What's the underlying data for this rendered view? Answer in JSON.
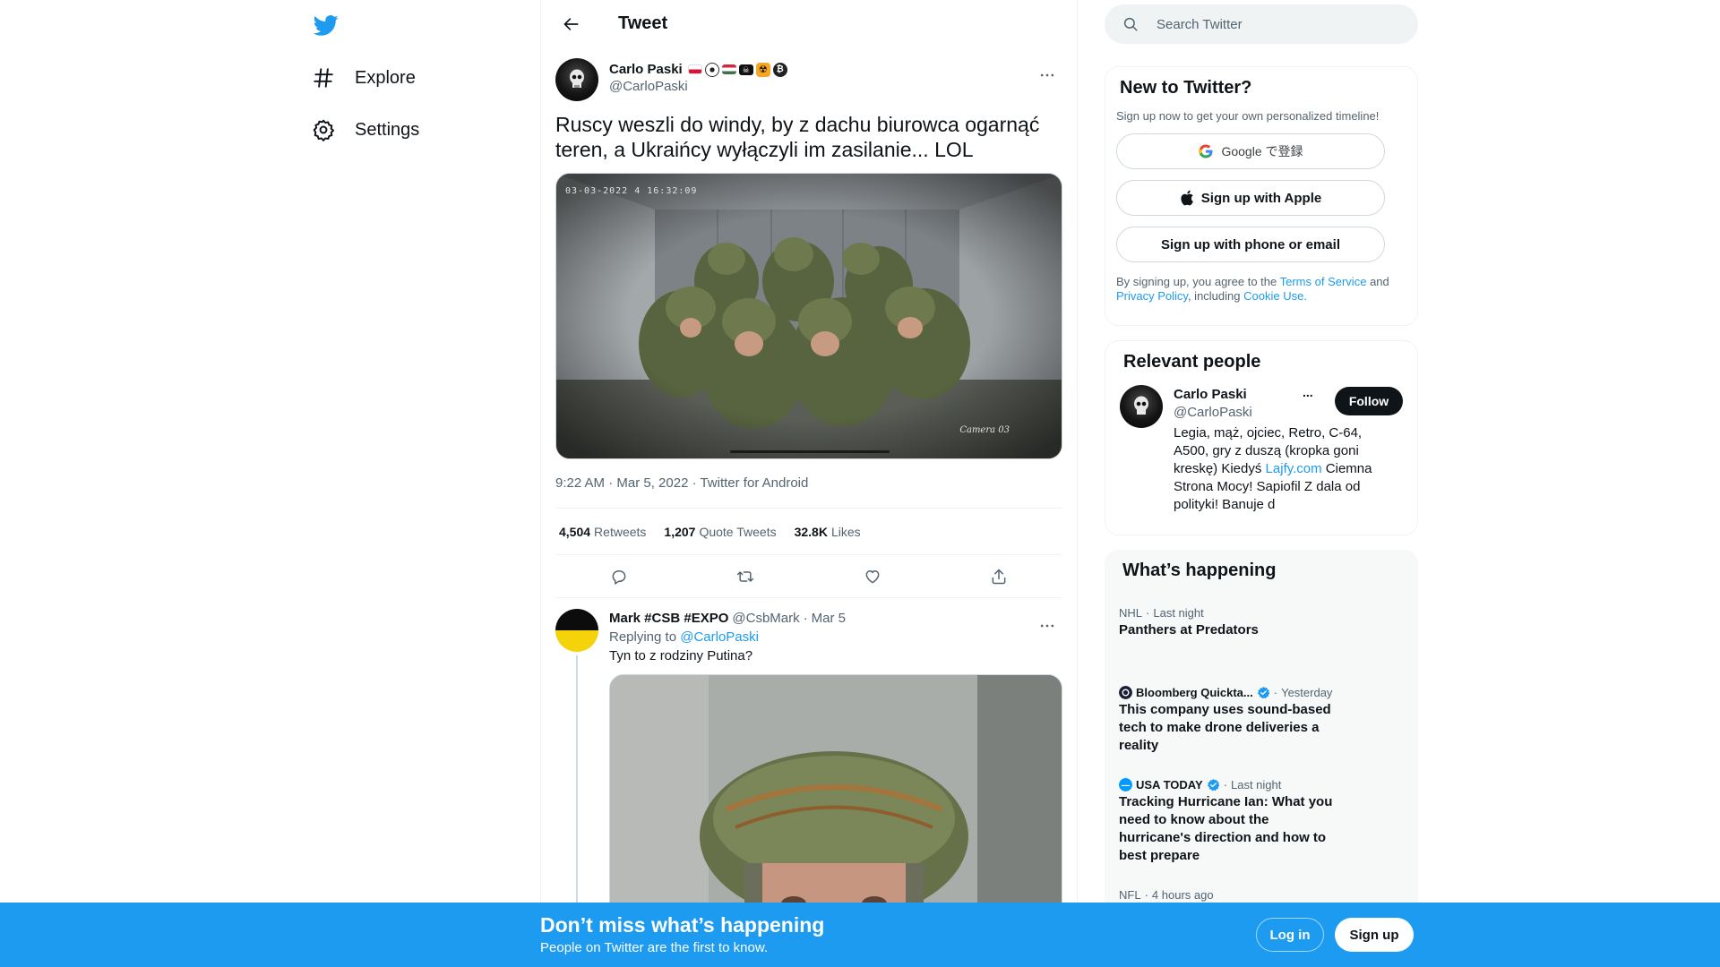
{
  "nav": {
    "explore_label": "Explore",
    "settings_label": "Settings"
  },
  "header": {
    "title": "Tweet"
  },
  "tweet": {
    "author_name": "Carlo Paski",
    "author_handle": "@CarloPaski",
    "text": "Ruscy weszli do windy, by z dachu biurowca ogarnąć teren, a Ukraińcy wyłączyli im zasilanie... LOL",
    "media_timestamp": "03-03-2022 4 16:32:09",
    "media_camera_label": "Camera 03",
    "meta": "9:22 AM · Mar 5, 2022 · Twitter for Android",
    "stats": {
      "retweets_count": "4,504",
      "retweets_label": "Retweets",
      "quotes_count": "1,207",
      "quotes_label": "Quote Tweets",
      "likes_count": "32.8K",
      "likes_label": "Likes"
    }
  },
  "reply": {
    "name": "Mark #CSB #EXPO",
    "handle": "@CsbMark",
    "separator": "·",
    "date": "Mar 5",
    "replying_prefix": "Replying to",
    "replying_to": "@CarloPaski",
    "text": "Tyn to z rodziny Putina?"
  },
  "search": {
    "placeholder": "Search Twitter"
  },
  "new_to_twitter": {
    "title": "New to Twitter?",
    "subtitle": "Sign up now to get your own personalized timeline!",
    "google_label": "Google で登録",
    "apple_label": "Sign up with Apple",
    "phone_label": "Sign up with phone or email",
    "legal_prefix": "By signing up, you agree to the",
    "terms": "Terms of Service",
    "and": "and",
    "privacy": "Privacy Policy",
    "including": ", including",
    "cookie": "Cookie Use."
  },
  "relevant_people": {
    "title": "Relevant people",
    "name": "Carlo Paski",
    "handle": "@CarloPaski",
    "dots": "...",
    "follow_label": "Follow",
    "bio_before": "Legia, mąż, ojciec, Retro, C-64, A500, gry z duszą (kropka goni kreskę) Kiedyś ",
    "bio_link": "Lajfy.com",
    "bio_after": " Ciemna Strona Mocy! Sapiofil Z dala od polityki! Banuje d"
  },
  "happening": {
    "title": "What’s happening",
    "trends": [
      {
        "source": "NHL",
        "sep": "·",
        "time": "Last night",
        "title": "Panthers at Predators"
      },
      {
        "source": "Bloomberg Quickta...",
        "sep": "·",
        "time": "Yesterday",
        "title": "This company uses sound-based tech to make drone deliveries a reality"
      },
      {
        "source": "USA TODAY",
        "sep": "·",
        "time": "Last night",
        "title": "Tracking Hurricane Ian: What you need to know about the hurricane's direction and how to best prepare"
      },
      {
        "source": "NFL",
        "sep": "·",
        "time": "4 hours ago",
        "title": ""
      }
    ]
  },
  "banner": {
    "title": "Don’t miss what’s happening",
    "subtitle": "People on Twitter are the first to know.",
    "login_label": "Log in",
    "signup_label": "Sign up"
  },
  "colors": {
    "brand_blue": "#1d9bf0",
    "text_primary": "#0f1419",
    "text_secondary": "#536471",
    "border": "#eff3f4"
  },
  "icons": [
    "twitter-logo-icon",
    "hashtag-icon",
    "gear-icon",
    "back-arrow-icon",
    "more-icon",
    "reply-icon",
    "retweet-icon",
    "like-icon",
    "share-icon",
    "search-icon",
    "google-icon",
    "apple-icon",
    "verified-icon"
  ]
}
